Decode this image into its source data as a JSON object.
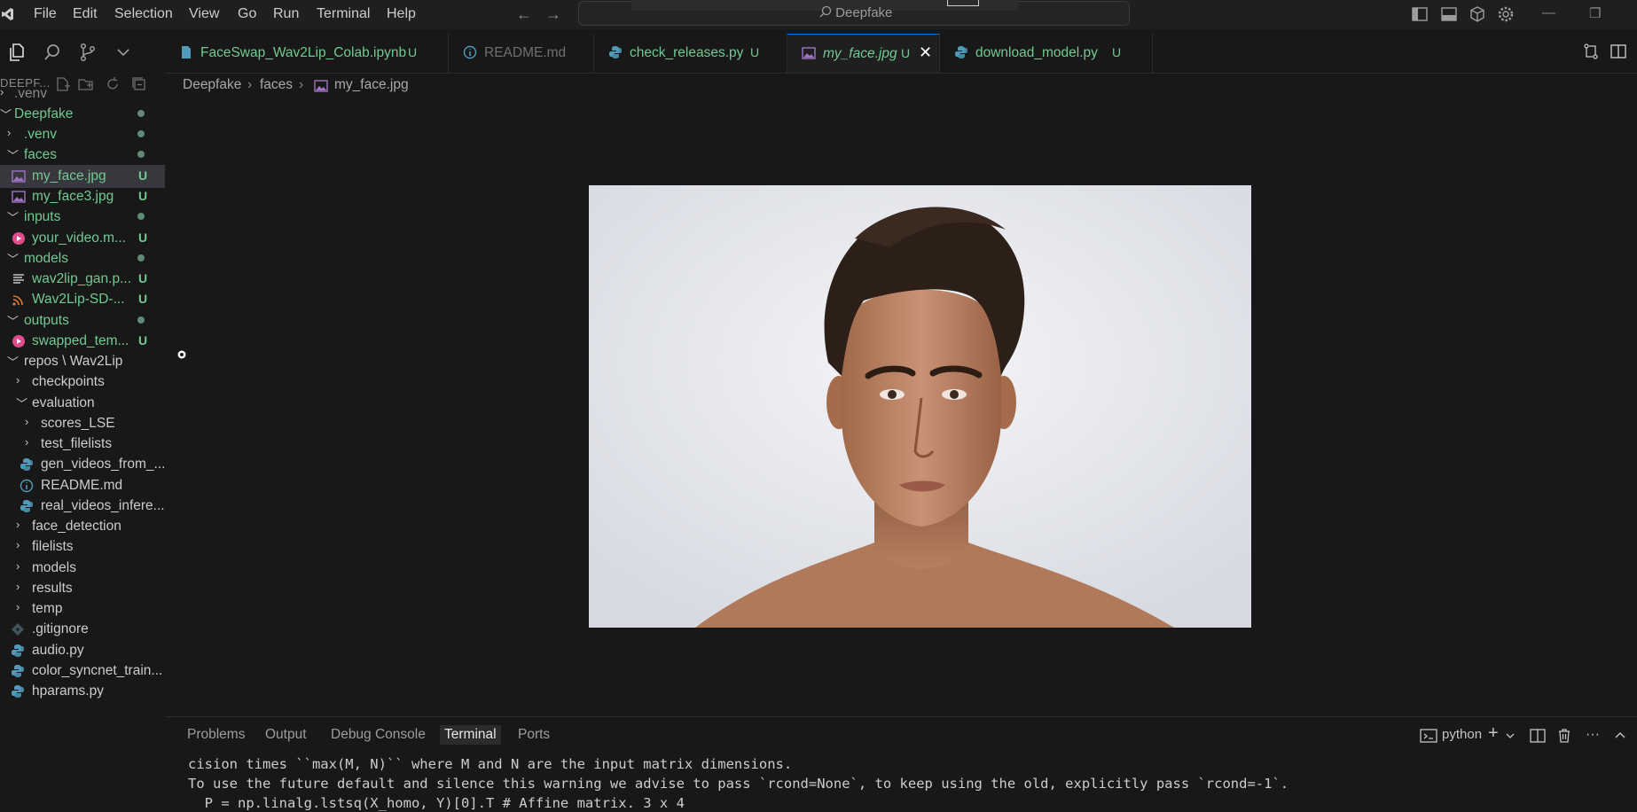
{
  "titlebar": {
    "menus": [
      "File",
      "Edit",
      "Selection",
      "View",
      "Go",
      "Run",
      "Terminal",
      "Help"
    ],
    "search_label": "Deepfake"
  },
  "explorer": {
    "title": "DEEPF...",
    "tree": [
      {
        "label": ".venv",
        "indent": 0,
        "kind": "folder",
        "chev": "›",
        "status": "",
        "style": "dim"
      },
      {
        "label": "Deepfake",
        "indent": 0,
        "kind": "folder",
        "chev": "⌄",
        "status": "dot",
        "style": "folder-git"
      },
      {
        "label": ".venv",
        "indent": 1,
        "kind": "folder",
        "chev": "›",
        "status": "dot",
        "style": "folder-git"
      },
      {
        "label": "faces",
        "indent": 1,
        "kind": "folder",
        "chev": "⌄",
        "status": "dot",
        "style": "folder-git"
      },
      {
        "label": "my_face.jpg",
        "indent": 2,
        "kind": "image",
        "status": "U",
        "style": "git",
        "selected": true
      },
      {
        "label": "my_face3.jpg",
        "indent": 2,
        "kind": "image",
        "status": "U",
        "style": "git"
      },
      {
        "label": "inputs",
        "indent": 1,
        "kind": "folder",
        "chev": "⌄",
        "status": "dot",
        "style": "folder-git"
      },
      {
        "label": "your_video.m...",
        "indent": 2,
        "kind": "video",
        "status": "U",
        "style": "git"
      },
      {
        "label": "models",
        "indent": 1,
        "kind": "folder",
        "chev": "⌄",
        "status": "dot",
        "style": "folder-git"
      },
      {
        "label": "wav2lip_gan.p...",
        "indent": 2,
        "kind": "text",
        "status": "U",
        "style": "git"
      },
      {
        "label": "Wav2Lip-SD-...",
        "indent": 2,
        "kind": "rss",
        "status": "U",
        "style": "git"
      },
      {
        "label": "outputs",
        "indent": 1,
        "kind": "folder",
        "chev": "⌄",
        "status": "dot",
        "style": "folder-git"
      },
      {
        "label": "swapped_tem...",
        "indent": 2,
        "kind": "video",
        "status": "U",
        "style": "git"
      },
      {
        "label": "repos \\ Wav2Lip",
        "indent": 1,
        "kind": "folder",
        "chev": "⌄",
        "status": "",
        "style": "normal"
      },
      {
        "label": "checkpoints",
        "indent": 2,
        "kind": "folder",
        "chev": "›",
        "status": "",
        "style": "normal"
      },
      {
        "label": "evaluation",
        "indent": 2,
        "kind": "folder",
        "chev": "⌄",
        "status": "",
        "style": "normal"
      },
      {
        "label": "scores_LSE",
        "indent": 3,
        "kind": "folder",
        "chev": "›",
        "status": "",
        "style": "normal"
      },
      {
        "label": "test_filelists",
        "indent": 3,
        "kind": "folder",
        "chev": "›",
        "status": "",
        "style": "normal"
      },
      {
        "label": "gen_videos_from_...",
        "indent": 3,
        "kind": "python",
        "status": "",
        "style": "normal"
      },
      {
        "label": "README.md",
        "indent": 3,
        "kind": "info",
        "status": "",
        "style": "normal"
      },
      {
        "label": "real_videos_infere...",
        "indent": 3,
        "kind": "python",
        "status": "",
        "style": "normal"
      },
      {
        "label": "face_detection",
        "indent": 2,
        "kind": "folder",
        "chev": "›",
        "status": "",
        "style": "normal"
      },
      {
        "label": "filelists",
        "indent": 2,
        "kind": "folder",
        "chev": "›",
        "status": "",
        "style": "normal"
      },
      {
        "label": "models",
        "indent": 2,
        "kind": "folder",
        "chev": "›",
        "status": "",
        "style": "normal"
      },
      {
        "label": "results",
        "indent": 2,
        "kind": "folder",
        "chev": "›",
        "status": "",
        "style": "normal"
      },
      {
        "label": "temp",
        "indent": 2,
        "kind": "folder",
        "chev": "›",
        "status": "",
        "style": "normal"
      },
      {
        "label": ".gitignore",
        "indent": 1,
        "kind": "git",
        "status": "",
        "style": "normal"
      },
      {
        "label": "audio.py",
        "indent": 1,
        "kind": "python",
        "status": "",
        "style": "normal"
      },
      {
        "label": "color_syncnet_train...",
        "indent": 1,
        "kind": "python",
        "status": "",
        "style": "normal"
      },
      {
        "label": "hparams.py",
        "indent": 1,
        "kind": "python",
        "status": "",
        "style": "normal"
      }
    ]
  },
  "tabs": [
    {
      "label": "FaceSwap_Wav2Lip_Colab.ipynb",
      "badge": "U",
      "kind": "notebook",
      "active": false,
      "dim": false
    },
    {
      "label": "README.md",
      "badge": "",
      "kind": "info",
      "active": false,
      "dim": true
    },
    {
      "label": "check_releases.py",
      "badge": "U",
      "kind": "python",
      "active": false,
      "dim": false
    },
    {
      "label": "my_face.jpg",
      "badge": "U",
      "kind": "image",
      "active": true,
      "dim": false
    },
    {
      "label": "download_model.py",
      "badge": "U",
      "kind": "python",
      "active": false,
      "dim": false
    }
  ],
  "breadcrumb": {
    "root": "Deepfake",
    "folder": "faces",
    "file": "my_face.jpg"
  },
  "panel": {
    "tabs": [
      "Problems",
      "Output",
      "Debug Console",
      "Terminal",
      "Ports"
    ],
    "active_tab": "Terminal",
    "terminal_name": "python",
    "lines": [
      "cision times ``max(M, N)`` where M and N are the input matrix dimensions.",
      "To use the future default and silence this warning we advise to pass `rcond=None`, to keep using the old, explicitly pass `rcond=-1`.",
      "  P = np.linalg.lstsq(X_homo, Y)[0].T # Affine matrix. 3 x 4"
    ]
  },
  "colors": {
    "git_untracked": "#73c991",
    "background": "#181818",
    "accent": "#0078d4"
  }
}
